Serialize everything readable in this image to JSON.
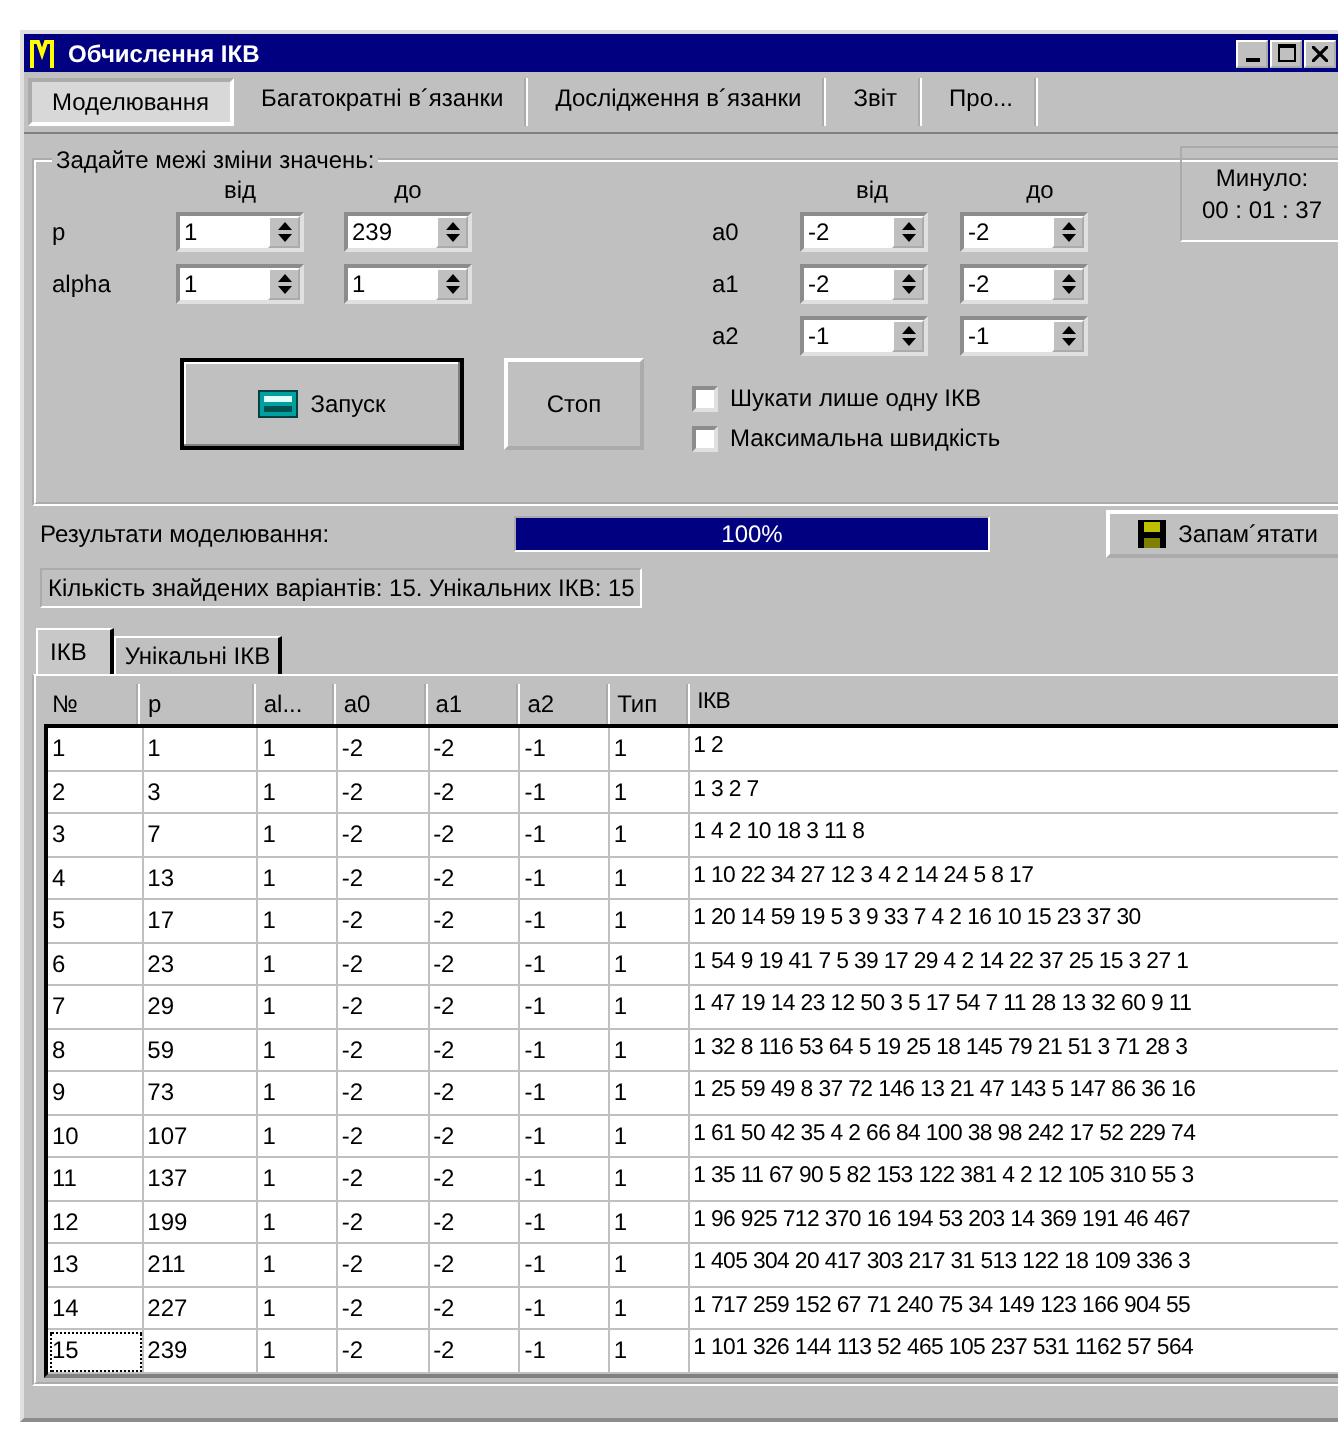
{
  "window": {
    "title": "Обчислення ІКВ"
  },
  "tabs": [
    {
      "label": "Моделювання",
      "selected": true
    },
    {
      "label": "Багатократні в´язанки",
      "selected": false
    },
    {
      "label": "Дослідження в´язанки",
      "selected": false
    },
    {
      "label": "Звіт",
      "selected": false
    },
    {
      "label": "Про...",
      "selected": false
    }
  ],
  "limits": {
    "title": "Задайте межі зміни значень:",
    "left_headers": {
      "from": "від",
      "to": "до"
    },
    "right_headers": {
      "from": "від",
      "to": "до"
    },
    "left_params": [
      {
        "name": "p",
        "from": "1",
        "to": "239"
      },
      {
        "name": "alpha",
        "from": "1",
        "to": "1"
      }
    ],
    "right_params": [
      {
        "name": "a0",
        "from": "-2",
        "to": "-2"
      },
      {
        "name": "a1",
        "from": "-2",
        "to": "-2"
      },
      {
        "name": "a2",
        "from": "-1",
        "to": "-1"
      }
    ],
    "run_button": "Запуск",
    "stop_button": "Стоп",
    "options": [
      {
        "label": "Шукати лише одну ІКВ",
        "checked": false
      },
      {
        "label": "Максимальна швидкість",
        "checked": false
      }
    ],
    "elapsed": {
      "label": "Минуло:",
      "value": "00 : 01 : 37"
    }
  },
  "results": {
    "label": "Результати моделювання:",
    "progress": {
      "level": 1,
      "text": "100%"
    },
    "save_button": "Запам´ятати",
    "summary": "Кількість знайдених варіантів: 15. Унікальних ІКВ: 15"
  },
  "result_tabs": [
    {
      "label": "ІКВ",
      "selected": true
    },
    {
      "label": "Унікальні ІКВ",
      "selected": false
    }
  ],
  "table": {
    "columns": [
      "№",
      "p",
      "al...",
      "a0",
      "a1",
      "a2",
      "Тип",
      "ІКВ"
    ],
    "rows": [
      [
        "1",
        "1",
        "1",
        "-2",
        "-2",
        "-1",
        "1",
        "1 2"
      ],
      [
        "2",
        "3",
        "1",
        "-2",
        "-2",
        "-1",
        "1",
        "1 3 2 7"
      ],
      [
        "3",
        "7",
        "1",
        "-2",
        "-2",
        "-1",
        "1",
        "1 4 2 10 18 3 11 8"
      ],
      [
        "4",
        "13",
        "1",
        "-2",
        "-2",
        "-1",
        "1",
        "1 10 22 34 27 12 3 4 2 14 24 5 8 17"
      ],
      [
        "5",
        "17",
        "1",
        "-2",
        "-2",
        "-1",
        "1",
        "1 20 14 59 19 5 3 9 33 7 4 2 16 10 15 23 37 30"
      ],
      [
        "6",
        "23",
        "1",
        "-2",
        "-2",
        "-1",
        "1",
        "1 54 9 19 41 7 5 39 17 29 4 2 14 22 37 25 15 3 27 1"
      ],
      [
        "7",
        "29",
        "1",
        "-2",
        "-2",
        "-1",
        "1",
        "1 47 19 14 23 12 50 3 5 17 54 7 11 28 13 32 60 9 11"
      ],
      [
        "8",
        "59",
        "1",
        "-2",
        "-2",
        "-1",
        "1",
        "1 32 8 116 53 64 5 19 25 18 145 79 21 51 3 71 28 3"
      ],
      [
        "9",
        "73",
        "1",
        "-2",
        "-2",
        "-1",
        "1",
        "1 25 59 49 8 37 72 146 13 21 47 143 5 147 86 36 16"
      ],
      [
        "10",
        "107",
        "1",
        "-2",
        "-2",
        "-1",
        "1",
        "1 61 50 42 35 4 2 66 84 100 38 98 242 17 52 229 74"
      ],
      [
        "11",
        "137",
        "1",
        "-2",
        "-2",
        "-1",
        "1",
        "1 35 11 67 90 5 82 153 122 381 4 2 12 105 310 55 3"
      ],
      [
        "12",
        "199",
        "1",
        "-2",
        "-2",
        "-1",
        "1",
        "1 96 925 712 370 16 194 53 203 14 369 191 46 467"
      ],
      [
        "13",
        "211",
        "1",
        "-2",
        "-2",
        "-1",
        "1",
        "1 405 304 20 417 303 217 31 513 122 18 109 336 3"
      ],
      [
        "14",
        "227",
        "1",
        "-2",
        "-2",
        "-1",
        "1",
        "1 717 259 152 67 71 240 75 34 149 123 166 904 55"
      ],
      [
        "15",
        "239",
        "1",
        "-2",
        "-2",
        "-1",
        "1",
        "1 101 326 144 113 52 465 105 237 531 1162 57 564"
      ]
    ]
  }
}
